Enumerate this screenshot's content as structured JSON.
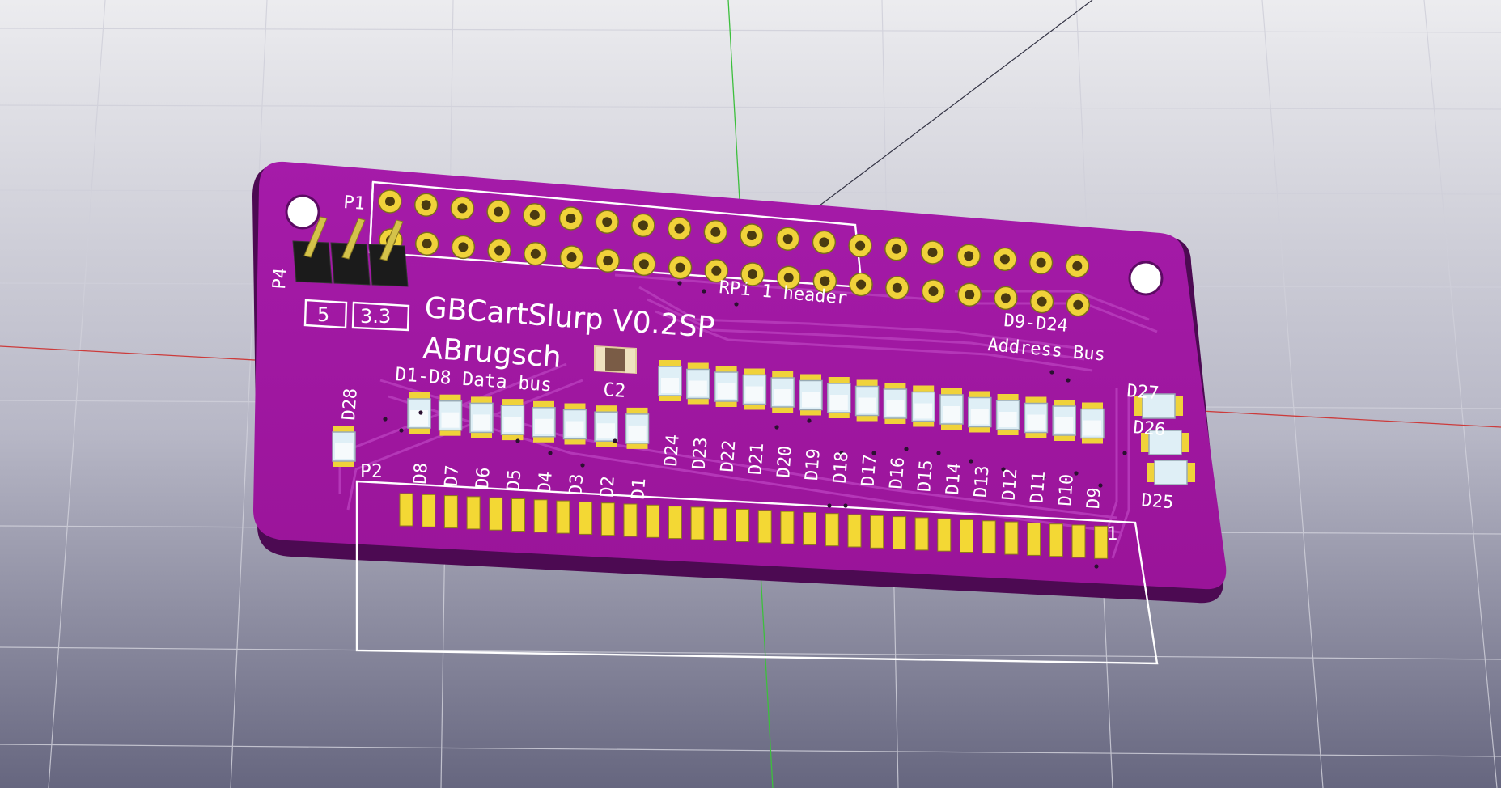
{
  "colors": {
    "sky_top": "#ebebee",
    "sky_bottom": "#6b6b85",
    "board": "#a219a6",
    "board_dark": "#5c0b63",
    "copper_trace": "#b233b4",
    "silkscreen": "#ffffff",
    "pad": "#f3d834",
    "led_body": "#ddeef5",
    "axis_x": "#d23a3a",
    "axis_y": "#3fbf3f",
    "grid": "#c8c8d2"
  },
  "board": {
    "title": "GBCartSlurp V0.2SP",
    "author": "ABrugsch",
    "p1_label": "P1",
    "p1_caption": "RPi 1 header",
    "p4_label": "P4",
    "p4_pin_5": "5",
    "p4_pin_33": "3.3",
    "data_bus_label": "D1-D8 Data bus",
    "cap_label": "C2",
    "address_label_1": "D9-D24",
    "address_label_2": "Address Bus",
    "p2_label": "P2",
    "p2_pin1": "1",
    "d28_label": "D28",
    "d27_label": "D27",
    "d26_label": "D26",
    "d25_label": "D25",
    "data_leds": [
      "D8",
      "D7",
      "D6",
      "D5",
      "D4",
      "D3",
      "D2",
      "D1"
    ],
    "address_leds": [
      "D24",
      "D23",
      "D22",
      "D21",
      "D20",
      "D19",
      "D18",
      "D17",
      "D16",
      "D15",
      "D14",
      "D13",
      "D12",
      "D11",
      "D10",
      "D9"
    ]
  }
}
